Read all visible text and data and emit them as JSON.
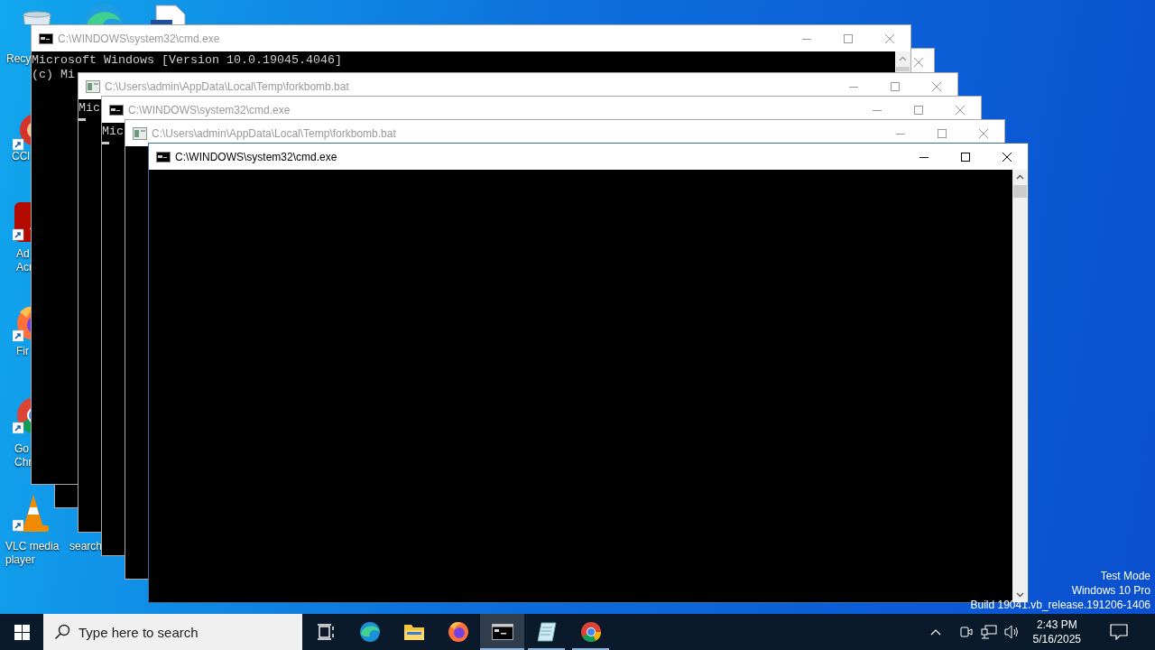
{
  "desktop": {
    "icons": [
      {
        "kind": "trash",
        "lines": [
          "Recy"
        ]
      },
      {
        "kind": "edge"
      },
      {
        "kind": "document"
      },
      {
        "kind": "cleaner",
        "lines": [
          "CCl"
        ]
      },
      {
        "kind": "acrobat",
        "lines": [
          "Ad",
          "Acr"
        ]
      },
      {
        "kind": "firefox",
        "lines": [
          "Fir"
        ]
      },
      {
        "kind": "chrome",
        "lines": [
          "Go",
          "Chr"
        ]
      },
      {
        "kind": "vlc",
        "lines": [
          "VLC media",
          "player"
        ]
      },
      {
        "lines": [
          "search"
        ]
      }
    ],
    "watermark_lines": [
      "Test Mode",
      "Windows 10 Pro",
      "Build 19041.vb_release.191206-1406"
    ]
  },
  "windows": [
    {
      "active": false
    },
    {
      "kind": "cmd",
      "title": "C:\\WINDOWS\\system32\\cmd.exe",
      "active": false,
      "lines": [
        "Microsoft Windows [Version 10.0.19045.4046]",
        "(c) Mi"
      ],
      "cursor": false
    },
    {
      "kind": "batch",
      "title": "C:\\Users\\admin\\AppData\\Local\\Temp\\forkbomb.bat",
      "active": false,
      "lines": [
        "Mic"
      ],
      "cursor": true
    },
    {
      "kind": "cmd",
      "title": "C:\\WINDOWS\\system32\\cmd.exe",
      "active": false,
      "lines": [
        "Mic"
      ],
      "cursor": true
    },
    {
      "kind": "batch",
      "title": "C:\\Users\\admin\\AppData\\Local\\Temp\\forkbomb.bat",
      "active": false
    },
    {
      "kind": "cmd",
      "title": "C:\\WINDOWS\\system32\\cmd.exe",
      "active": true
    }
  ],
  "taskbar": {
    "search": {
      "placeholder": "Type here to search"
    },
    "apps": [
      {
        "kind": "taskview",
        "running": false,
        "selected": false
      },
      {
        "kind": "edge",
        "running": false,
        "selected": false
      },
      {
        "kind": "explorer",
        "running": false,
        "selected": false
      },
      {
        "kind": "firefox",
        "running": false,
        "selected": false
      },
      {
        "kind": "cmd",
        "running": true,
        "selected": true
      },
      {
        "kind": "notepad",
        "running": true,
        "selected": false
      },
      {
        "kind": "chrome",
        "running": true,
        "selected": false
      }
    ],
    "clock": {
      "time": "2:43 PM",
      "date": "5/16/2025"
    }
  }
}
